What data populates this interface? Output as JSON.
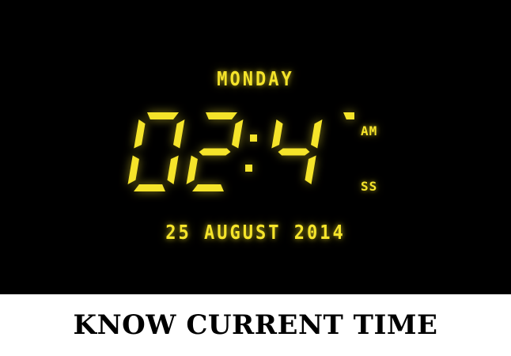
{
  "clock": {
    "day": "MONDAY",
    "time": "02:47",
    "period": "AM",
    "seconds_label": "SS",
    "date": "25 AUGUST 2014"
  },
  "caption": "KNOW CURRENT TIME",
  "colors": {
    "lcd": "#f5e42a",
    "background": "#000000",
    "caption_bg": "#ffffff"
  }
}
